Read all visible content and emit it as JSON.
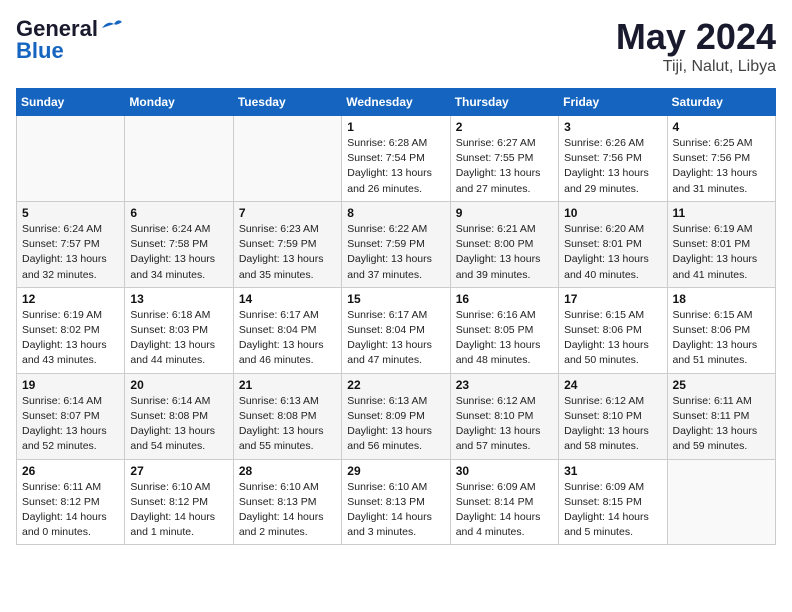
{
  "header": {
    "logo_general": "General",
    "logo_blue": "Blue",
    "month_year": "May 2024",
    "location": "Tiji, Nalut, Libya"
  },
  "weekdays": [
    "Sunday",
    "Monday",
    "Tuesday",
    "Wednesday",
    "Thursday",
    "Friday",
    "Saturday"
  ],
  "weeks": [
    [
      {
        "day": "",
        "info": ""
      },
      {
        "day": "",
        "info": ""
      },
      {
        "day": "",
        "info": ""
      },
      {
        "day": "1",
        "info": "Sunrise: 6:28 AM\nSunset: 7:54 PM\nDaylight: 13 hours\nand 26 minutes."
      },
      {
        "day": "2",
        "info": "Sunrise: 6:27 AM\nSunset: 7:55 PM\nDaylight: 13 hours\nand 27 minutes."
      },
      {
        "day": "3",
        "info": "Sunrise: 6:26 AM\nSunset: 7:56 PM\nDaylight: 13 hours\nand 29 minutes."
      },
      {
        "day": "4",
        "info": "Sunrise: 6:25 AM\nSunset: 7:56 PM\nDaylight: 13 hours\nand 31 minutes."
      }
    ],
    [
      {
        "day": "5",
        "info": "Sunrise: 6:24 AM\nSunset: 7:57 PM\nDaylight: 13 hours\nand 32 minutes."
      },
      {
        "day": "6",
        "info": "Sunrise: 6:24 AM\nSunset: 7:58 PM\nDaylight: 13 hours\nand 34 minutes."
      },
      {
        "day": "7",
        "info": "Sunrise: 6:23 AM\nSunset: 7:59 PM\nDaylight: 13 hours\nand 35 minutes."
      },
      {
        "day": "8",
        "info": "Sunrise: 6:22 AM\nSunset: 7:59 PM\nDaylight: 13 hours\nand 37 minutes."
      },
      {
        "day": "9",
        "info": "Sunrise: 6:21 AM\nSunset: 8:00 PM\nDaylight: 13 hours\nand 39 minutes."
      },
      {
        "day": "10",
        "info": "Sunrise: 6:20 AM\nSunset: 8:01 PM\nDaylight: 13 hours\nand 40 minutes."
      },
      {
        "day": "11",
        "info": "Sunrise: 6:19 AM\nSunset: 8:01 PM\nDaylight: 13 hours\nand 41 minutes."
      }
    ],
    [
      {
        "day": "12",
        "info": "Sunrise: 6:19 AM\nSunset: 8:02 PM\nDaylight: 13 hours\nand 43 minutes."
      },
      {
        "day": "13",
        "info": "Sunrise: 6:18 AM\nSunset: 8:03 PM\nDaylight: 13 hours\nand 44 minutes."
      },
      {
        "day": "14",
        "info": "Sunrise: 6:17 AM\nSunset: 8:04 PM\nDaylight: 13 hours\nand 46 minutes."
      },
      {
        "day": "15",
        "info": "Sunrise: 6:17 AM\nSunset: 8:04 PM\nDaylight: 13 hours\nand 47 minutes."
      },
      {
        "day": "16",
        "info": "Sunrise: 6:16 AM\nSunset: 8:05 PM\nDaylight: 13 hours\nand 48 minutes."
      },
      {
        "day": "17",
        "info": "Sunrise: 6:15 AM\nSunset: 8:06 PM\nDaylight: 13 hours\nand 50 minutes."
      },
      {
        "day": "18",
        "info": "Sunrise: 6:15 AM\nSunset: 8:06 PM\nDaylight: 13 hours\nand 51 minutes."
      }
    ],
    [
      {
        "day": "19",
        "info": "Sunrise: 6:14 AM\nSunset: 8:07 PM\nDaylight: 13 hours\nand 52 minutes."
      },
      {
        "day": "20",
        "info": "Sunrise: 6:14 AM\nSunset: 8:08 PM\nDaylight: 13 hours\nand 54 minutes."
      },
      {
        "day": "21",
        "info": "Sunrise: 6:13 AM\nSunset: 8:08 PM\nDaylight: 13 hours\nand 55 minutes."
      },
      {
        "day": "22",
        "info": "Sunrise: 6:13 AM\nSunset: 8:09 PM\nDaylight: 13 hours\nand 56 minutes."
      },
      {
        "day": "23",
        "info": "Sunrise: 6:12 AM\nSunset: 8:10 PM\nDaylight: 13 hours\nand 57 minutes."
      },
      {
        "day": "24",
        "info": "Sunrise: 6:12 AM\nSunset: 8:10 PM\nDaylight: 13 hours\nand 58 minutes."
      },
      {
        "day": "25",
        "info": "Sunrise: 6:11 AM\nSunset: 8:11 PM\nDaylight: 13 hours\nand 59 minutes."
      }
    ],
    [
      {
        "day": "26",
        "info": "Sunrise: 6:11 AM\nSunset: 8:12 PM\nDaylight: 14 hours\nand 0 minutes."
      },
      {
        "day": "27",
        "info": "Sunrise: 6:10 AM\nSunset: 8:12 PM\nDaylight: 14 hours\nand 1 minute."
      },
      {
        "day": "28",
        "info": "Sunrise: 6:10 AM\nSunset: 8:13 PM\nDaylight: 14 hours\nand 2 minutes."
      },
      {
        "day": "29",
        "info": "Sunrise: 6:10 AM\nSunset: 8:13 PM\nDaylight: 14 hours\nand 3 minutes."
      },
      {
        "day": "30",
        "info": "Sunrise: 6:09 AM\nSunset: 8:14 PM\nDaylight: 14 hours\nand 4 minutes."
      },
      {
        "day": "31",
        "info": "Sunrise: 6:09 AM\nSunset: 8:15 PM\nDaylight: 14 hours\nand 5 minutes."
      },
      {
        "day": "",
        "info": ""
      }
    ]
  ]
}
